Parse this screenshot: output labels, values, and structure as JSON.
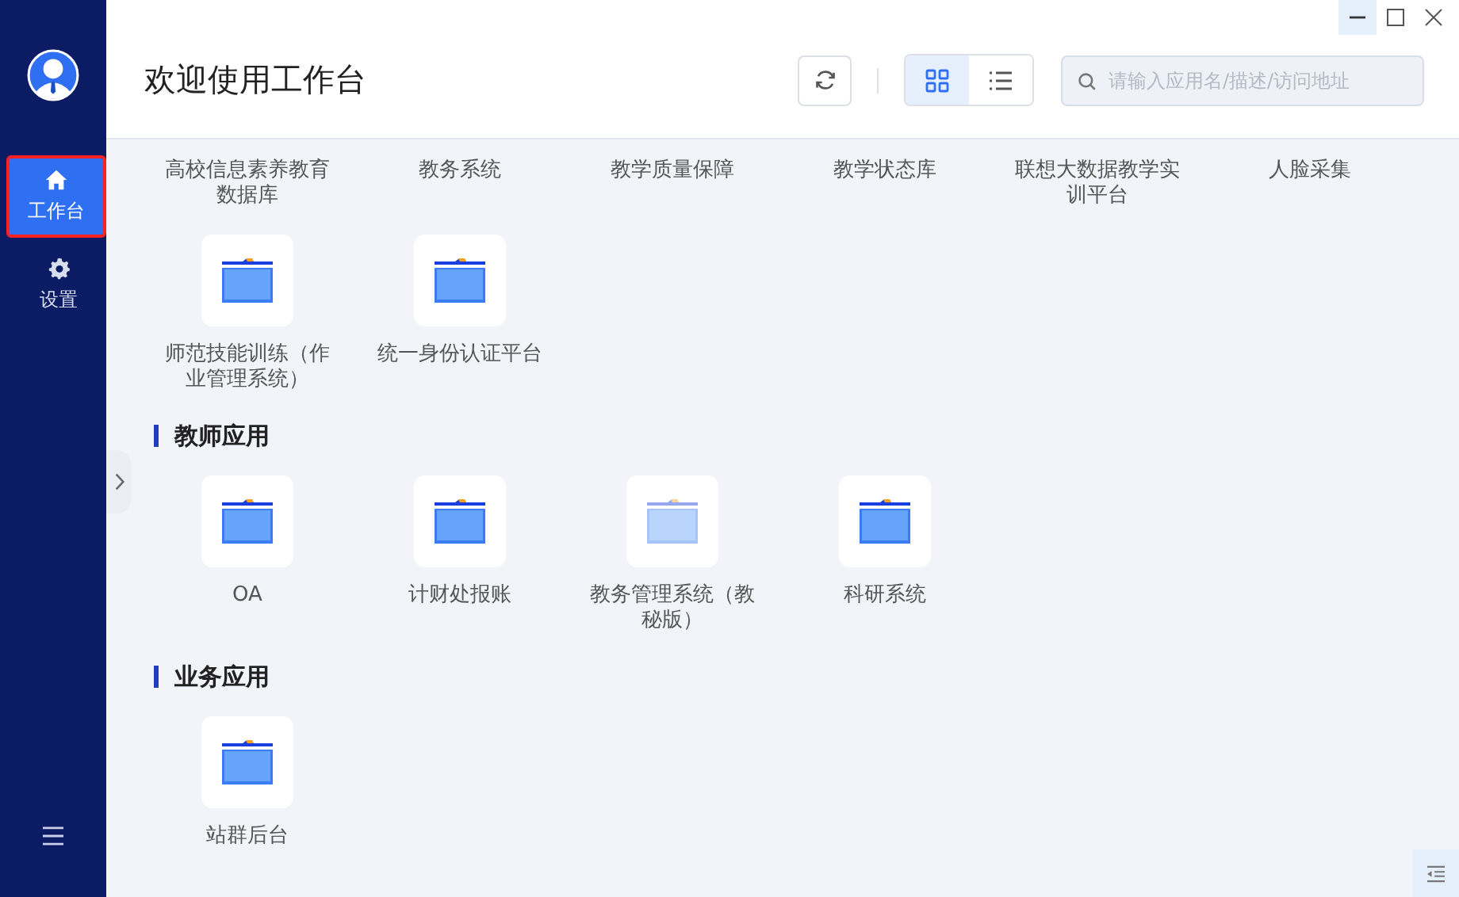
{
  "sidebar": {
    "items": [
      {
        "label": "工作台",
        "selected": true
      },
      {
        "label": "设置",
        "selected": false
      }
    ]
  },
  "header": {
    "title": "欢迎使用工作台",
    "views": [
      {
        "selected": true
      },
      {
        "selected": false
      }
    ],
    "search": {
      "placeholder": "请输入应用名/描述/访问地址"
    }
  },
  "sections": [
    {
      "items": [
        {
          "kind": "label-only",
          "label": "高校信息素养教育数据库"
        },
        {
          "kind": "label-only",
          "label": "教务系统"
        },
        {
          "kind": "label-only",
          "label": "教学质量保障"
        },
        {
          "kind": "label-only",
          "label": "教学状态库"
        },
        {
          "kind": "label-only",
          "label": "联想大数据教学实训平台"
        },
        {
          "kind": "label-only",
          "label": "人脸采集"
        },
        {
          "kind": "app",
          "label": "师范技能训练（作业管理系统）",
          "disabled": false
        },
        {
          "kind": "app",
          "label": "统一身份认证平台",
          "disabled": false
        }
      ]
    },
    {
      "title": "教师应用",
      "items": [
        {
          "kind": "app",
          "label": "OA",
          "disabled": false
        },
        {
          "kind": "app",
          "label": "计财处报账",
          "disabled": false
        },
        {
          "kind": "app",
          "label": "教务管理系统（教秘版）",
          "disabled": true
        },
        {
          "kind": "app",
          "label": "科研系统",
          "disabled": false
        }
      ]
    },
    {
      "title": "业务应用",
      "items": [
        {
          "kind": "app",
          "label": "站群后台",
          "disabled": false
        }
      ]
    }
  ]
}
